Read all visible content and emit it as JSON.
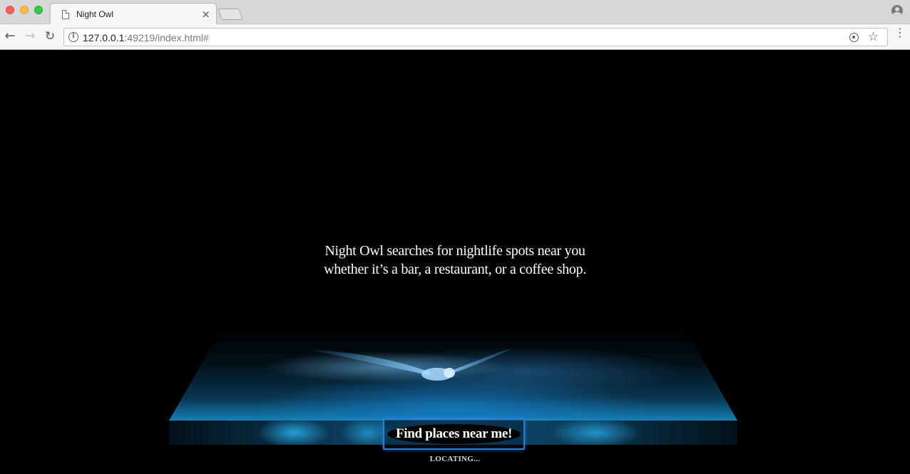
{
  "browser": {
    "tab_title": "Night Owl",
    "tab_close": "×",
    "url_host": "127.0.0.1",
    "url_rest": ":49219/index.html#",
    "back_glyph": "←",
    "forward_glyph": "→",
    "reload_glyph": "↻",
    "star_glyph": "☆",
    "menu_glyph": "⋮",
    "info_glyph": "i"
  },
  "page": {
    "tagline_line1": "Night Owl searches for nightlife spots near you",
    "tagline_line2": "whether it’s a bar, a restaurant, or a coffee shop.",
    "find_button_label": "Find places near me!",
    "status_text": "LOCATING..."
  },
  "colors": {
    "background": "#000000",
    "accent_blue": "#2a7cd4",
    "glow_blue": "#1581b8"
  }
}
